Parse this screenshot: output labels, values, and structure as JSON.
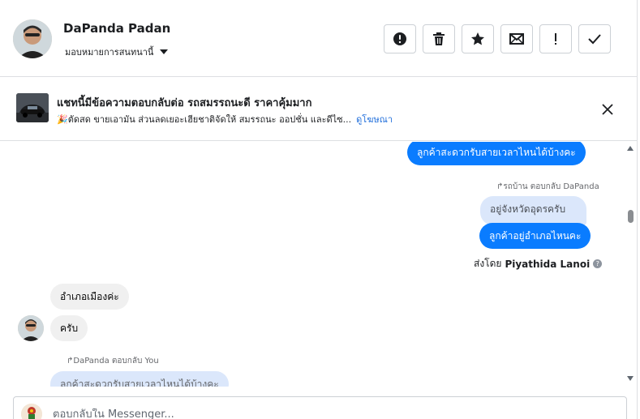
{
  "header": {
    "contact_name": "DaPanda Padan",
    "assign_label": "มอบหมายการสนทนานี้",
    "actions": [
      {
        "icon": "alert-circle-icon",
        "name": "mark-spam-button"
      },
      {
        "icon": "trash-icon",
        "name": "delete-button"
      },
      {
        "icon": "star-icon",
        "name": "star-button"
      },
      {
        "icon": "envelope-icon",
        "name": "mark-unread-button"
      },
      {
        "icon": "exclamation-icon",
        "name": "follow-up-button"
      },
      {
        "icon": "checkmark-icon",
        "name": "mark-done-button"
      }
    ]
  },
  "ad": {
    "title": "แชทนี้มีข้อความตอบกลับต่อ รถสมรรถนะดี ราคาคุ้มมาก",
    "description": "🎉ตัดสด ขายเอามัน ส่วนลดเยอะเฮียชาติจัดให้ สมรรถนะ ออปชั่น และดีไซ...",
    "link": "ดูโฆษณา"
  },
  "messages": {
    "m1": "ลูกค้าสะดวกรับสายเวลาไหนได้บ้างคะ",
    "reply_meta_1": "รถบ้าน ตอบกลับ DaPanda",
    "quoted_1": "อยู่จังหวัดอุดรครับ",
    "m2": "ลูกค้าอยู่อำเภอไหนคะ",
    "sent_by_prefix": "ส่งโดย",
    "sent_by_name": "Piyathida Lanoi",
    "in1": "อำเภอเมืองค่ะ",
    "in2": "ครับ",
    "reply_meta_2": "DaPanda ตอบกลับ You",
    "quoted_2": "ลูกค้าสะดวกรับสายเวลาไหนได้บ้างคะ"
  },
  "composer": {
    "placeholder": "ตอบกลับใน Messenger..."
  },
  "colors": {
    "outgoing_bubble": "#0a7cff",
    "incoming_bubble": "#f0f0f0",
    "link": "#216fdb"
  }
}
